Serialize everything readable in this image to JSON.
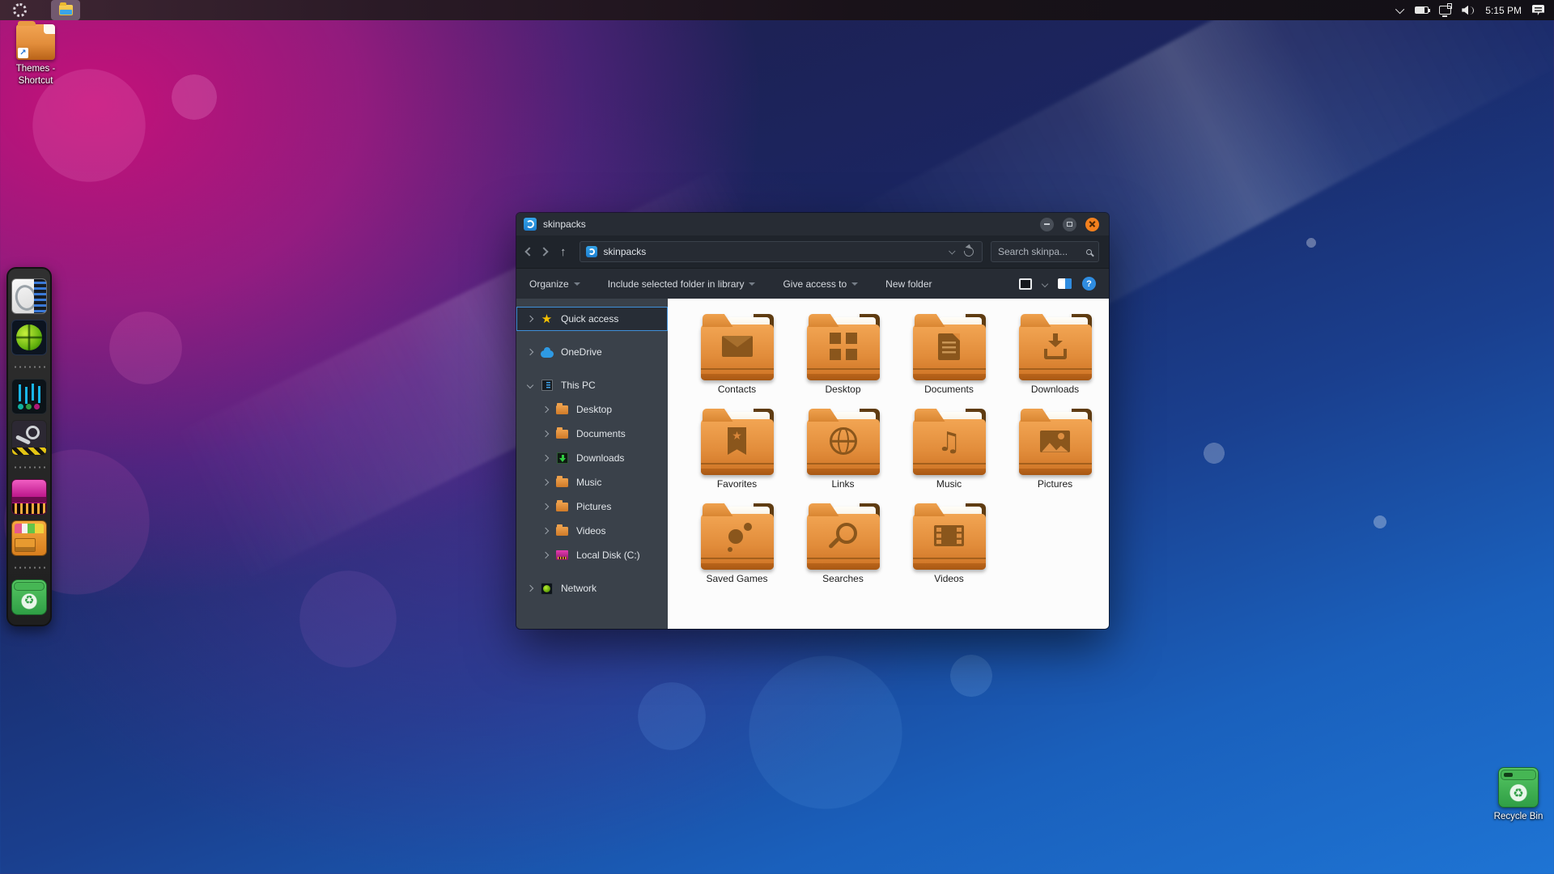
{
  "colors": {
    "accent_blue": "#2f8ce0",
    "close_button_orange": "#f2801e",
    "folder_orange": "#e28d3b",
    "selection_blue": "#3f8fd9"
  },
  "taskbar": {
    "launcher_icon": "ubuntu-logo-icon",
    "app_icon": "file-explorer-icon",
    "time": "5:15 PM",
    "tray_icons": [
      "chevron-down",
      "battery",
      "display",
      "volume",
      "time",
      "action-center"
    ]
  },
  "desktop": {
    "shortcut_label": "Themes - Shortcut",
    "recycle_bin_label": "Recycle Bin"
  },
  "dock": {
    "items": [
      "computer",
      "browser",
      "separator",
      "mixer",
      "steam",
      "separator",
      "disk",
      "cabinet",
      "separator",
      "recycle"
    ]
  },
  "window": {
    "title": "skinpacks",
    "controls": [
      "minimize",
      "maximize",
      "close"
    ],
    "address": {
      "value": "skinpacks"
    },
    "search": {
      "placeholder": "Search skinpa..."
    },
    "toolbar": {
      "items": [
        {
          "label": "Organize",
          "menu": true
        },
        {
          "label": "Include selected folder in library",
          "menu": true
        },
        {
          "label": "Give access to",
          "menu": true
        },
        {
          "label": "New folder",
          "menu": false
        }
      ],
      "right_icons": [
        "preview-pane",
        "chevron-down",
        "details-pane",
        "help"
      ]
    },
    "sidebar": {
      "sections": [
        {
          "items": [
            {
              "label": "Quick access",
              "icon": "star",
              "expander": "right",
              "selected": true
            }
          ]
        },
        {
          "items": [
            {
              "label": "OneDrive",
              "icon": "cloud",
              "expander": "right"
            }
          ]
        },
        {
          "items": [
            {
              "label": "This PC",
              "icon": "pc",
              "expander": "down"
            },
            {
              "label": "Desktop",
              "icon": "folder",
              "expander": "right",
              "child": true
            },
            {
              "label": "Documents",
              "icon": "folder",
              "expander": "right",
              "child": true
            },
            {
              "label": "Downloads",
              "icon": "downloads",
              "expander": "right",
              "child": true
            },
            {
              "label": "Music",
              "icon": "folder",
              "expander": "right",
              "child": true
            },
            {
              "label": "Pictures",
              "icon": "folder",
              "expander": "right",
              "child": true
            },
            {
              "label": "Videos",
              "icon": "folder",
              "expander": "right",
              "child": true
            },
            {
              "label": "Local Disk (C:)",
              "icon": "disk",
              "expander": "right",
              "child": true
            }
          ]
        },
        {
          "items": [
            {
              "label": "Network",
              "icon": "network",
              "expander": "right"
            }
          ]
        }
      ]
    },
    "folders": [
      {
        "label": "Contacts",
        "glyph": "envelope"
      },
      {
        "label": "Desktop",
        "glyph": "grid"
      },
      {
        "label": "Documents",
        "glyph": "doc"
      },
      {
        "label": "Downloads",
        "glyph": "download"
      },
      {
        "label": "Favorites",
        "glyph": "bookmark"
      },
      {
        "label": "Links",
        "glyph": "globe"
      },
      {
        "label": "Music",
        "glyph": "note"
      },
      {
        "label": "Pictures",
        "glyph": "image"
      },
      {
        "label": "Saved Games",
        "glyph": "dots"
      },
      {
        "label": "Searches",
        "glyph": "search"
      },
      {
        "label": "Videos",
        "glyph": "film"
      }
    ]
  }
}
